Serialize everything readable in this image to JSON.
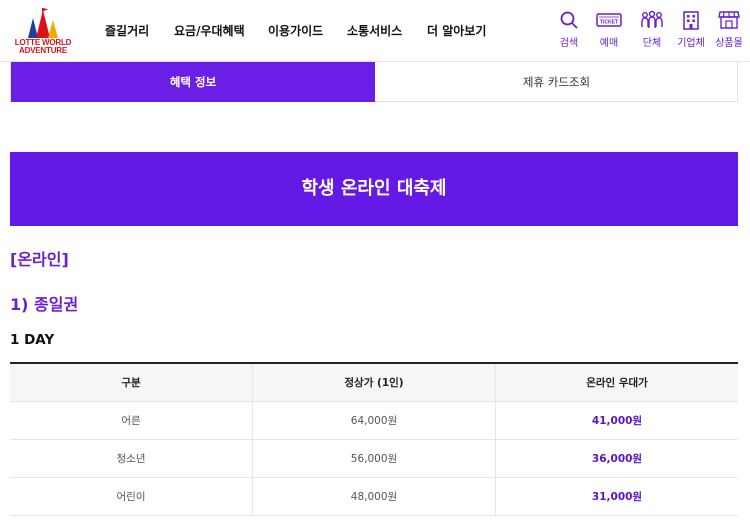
{
  "header": {
    "logo_line1": "LOTTE WORLD",
    "logo_line2": "ADVENTURE",
    "nav": [
      "즐길거리",
      "요금/우대혜택",
      "이용가이드",
      "소통서비스",
      "더 알아보기"
    ],
    "utilities": [
      {
        "icon": "search-icon",
        "label": "검색"
      },
      {
        "icon": "ticket-icon",
        "label": "예매"
      },
      {
        "icon": "group-icon",
        "label": "단체"
      },
      {
        "icon": "building-icon",
        "label": "기업체"
      },
      {
        "icon": "shop-icon",
        "label": "상품몰"
      }
    ],
    "ticket_icon_text": "TICKET"
  },
  "tabs": {
    "active": "혜택 정보",
    "inactive": "제휴 카드조회"
  },
  "banner_title": "학생 온라인 대축제",
  "section_online": "[온라인]",
  "section_oneday_pass": "1) 종일권",
  "subsection": "1 DAY",
  "table": {
    "headers": [
      "구분",
      "정상가 (1인)",
      "온라인 우대가"
    ],
    "rows": [
      [
        "어른",
        "64,000원",
        "41,000원"
      ],
      [
        "청소년",
        "56,000원",
        "36,000원"
      ],
      [
        "어린이",
        "48,000원",
        "31,000원"
      ]
    ]
  },
  "colors": {
    "accent": "#6a1ee6",
    "logo_red": "#d8121a"
  }
}
